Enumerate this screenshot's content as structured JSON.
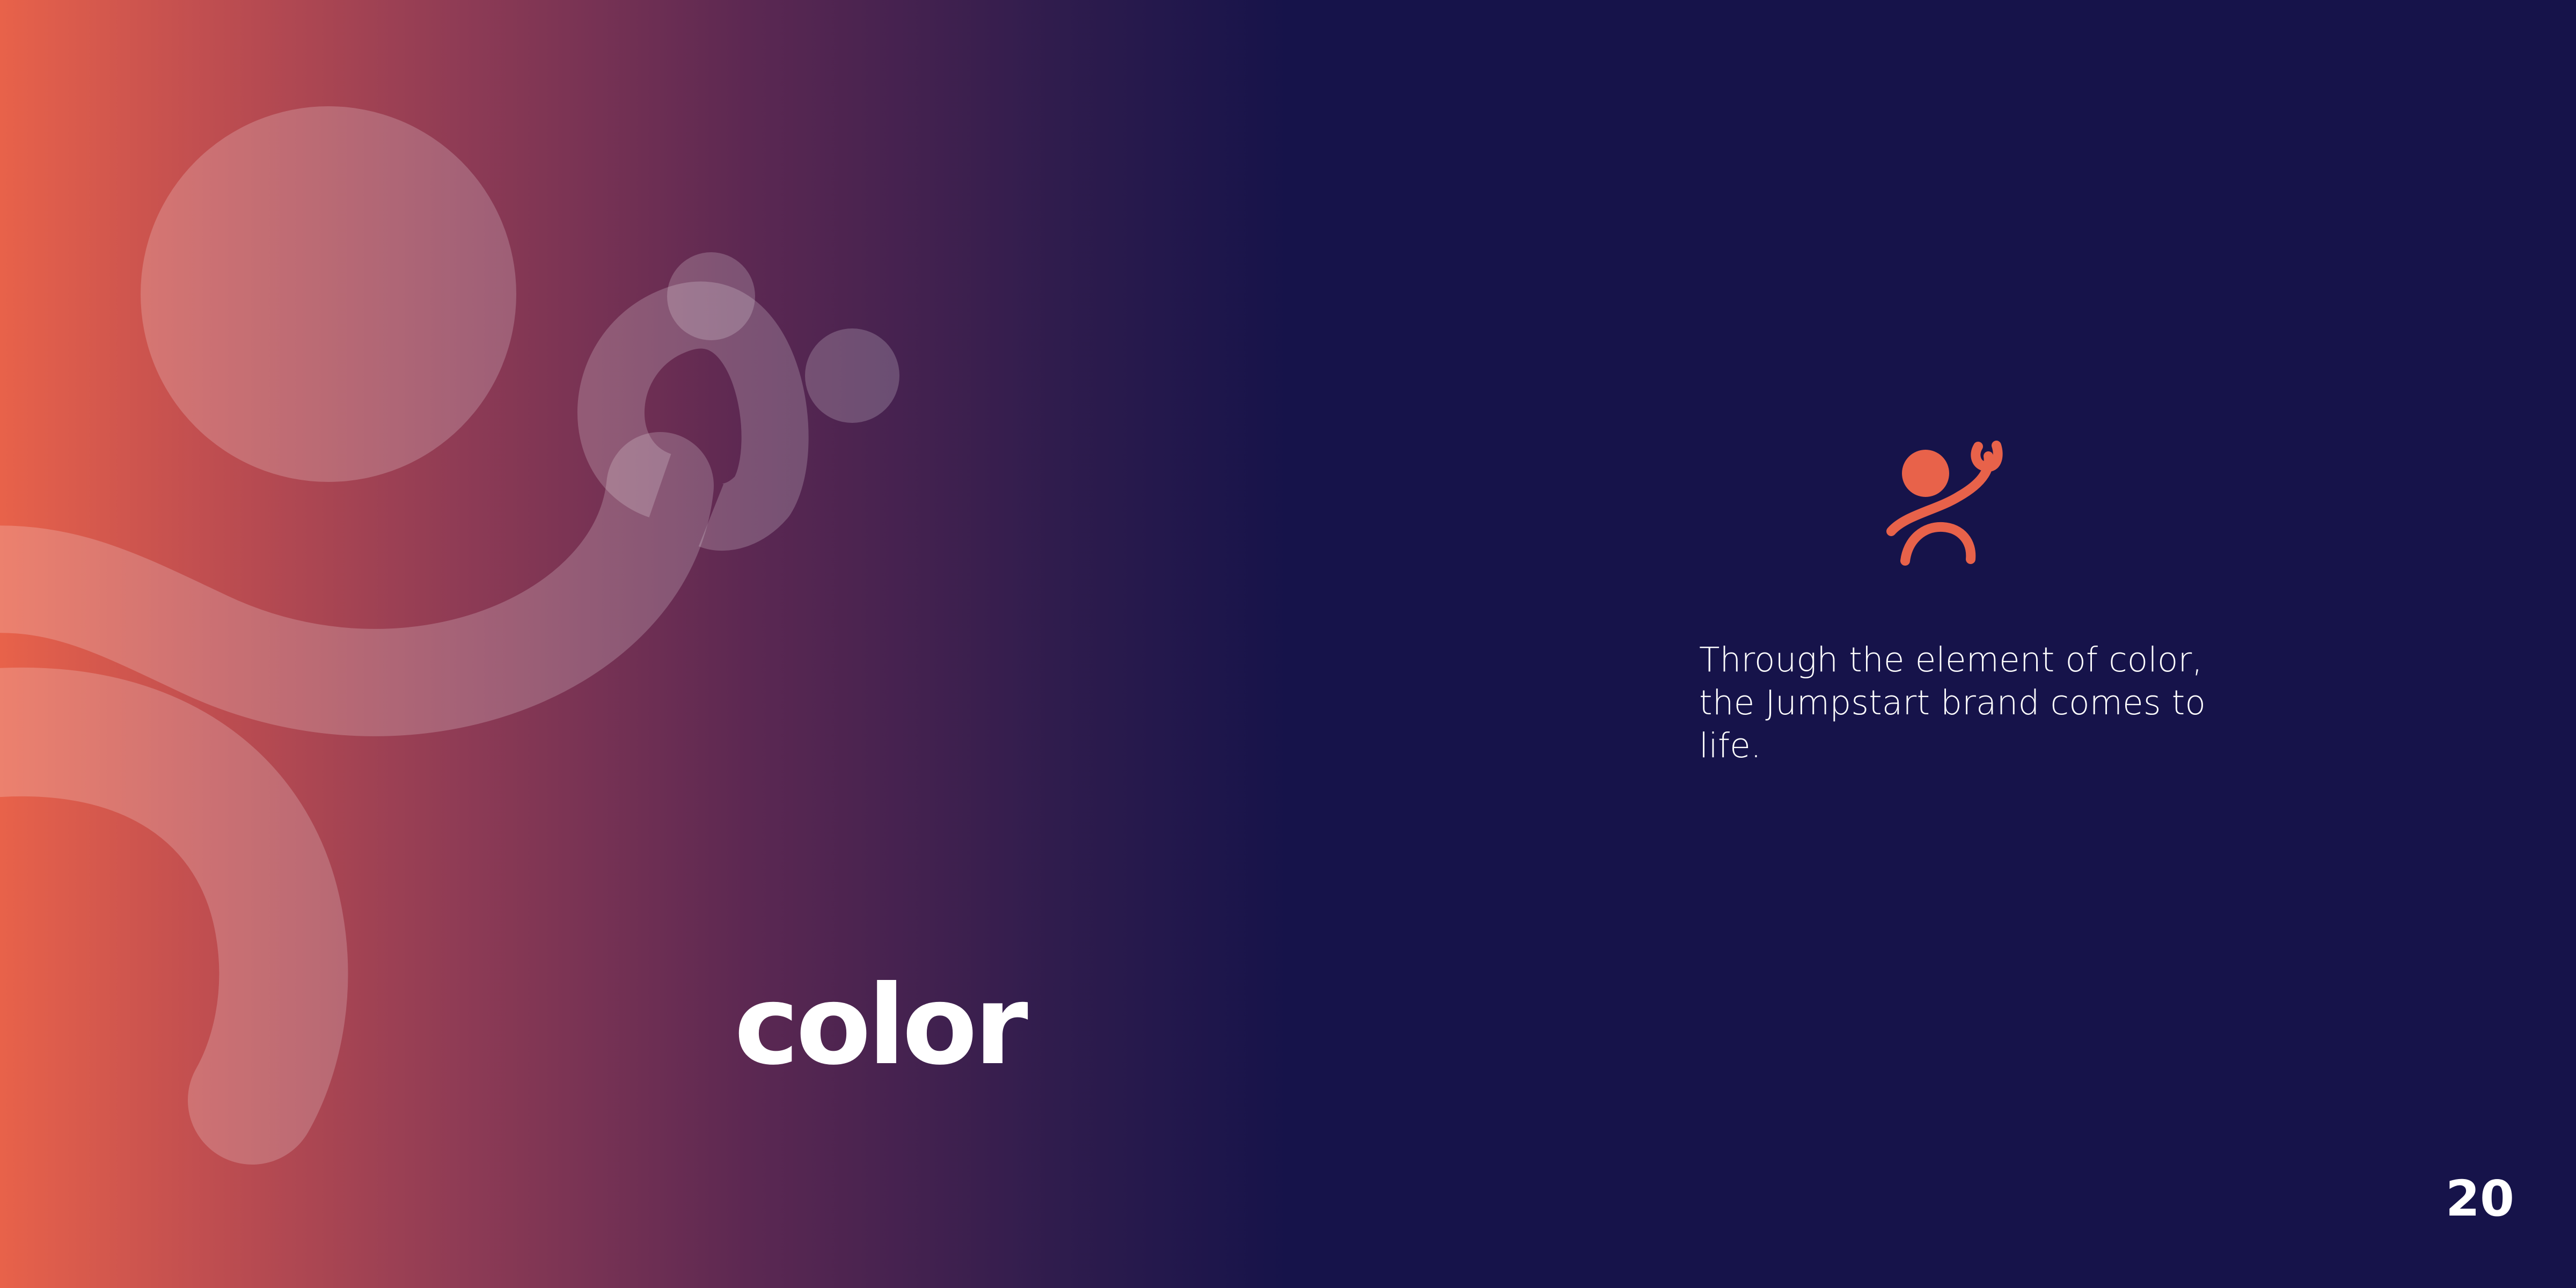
{
  "spread": {
    "left_page": {
      "title": "color",
      "background_gradient": [
        "#e8624a",
        "#c04e50",
        "#8e3b55",
        "#5c2852",
        "#2f1c4d",
        "#16134a"
      ],
      "decorative_figure": "jumpstart-figure-icon"
    },
    "right_page": {
      "background": "#16134a",
      "logo": {
        "icon": "jumpstart-logo-icon",
        "color": "#e8624a"
      },
      "body_text": "Through the element of color, the Jumpstart brand comes to life.",
      "page_number": "20"
    }
  },
  "colors": {
    "brand_orange": "#e8624a",
    "navy": "#16134a",
    "text": "#ffffff"
  }
}
